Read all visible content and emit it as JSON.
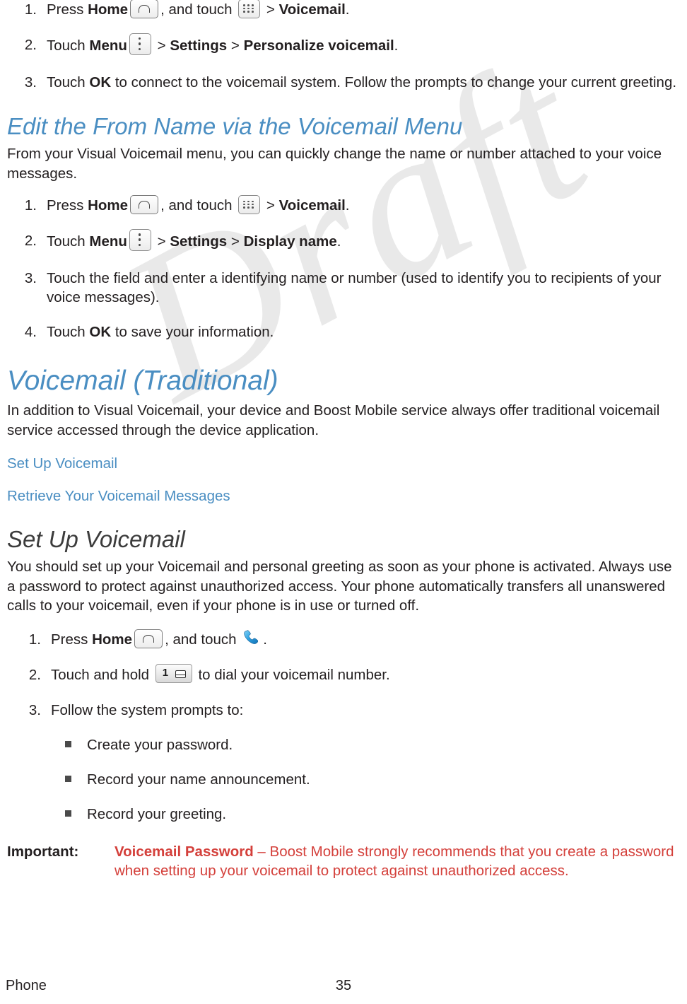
{
  "watermark": {
    "text": "Draft"
  },
  "steps_top": [
    {
      "num": "1.",
      "prefix": "Press ",
      "bold1": "Home",
      "mid": ", and touch ",
      "mid2": " > ",
      "bold2": "Voicemail",
      "suffix": "."
    },
    {
      "num": "2.",
      "prefix": "Touch ",
      "bold1": "Menu",
      "mid": " > ",
      "bold2": "Settings",
      "mid2": " > ",
      "bold3": "Personalize voicemail",
      "suffix": "."
    },
    {
      "num": "3.",
      "prefix": "Touch ",
      "bold1": "OK",
      "suffix": " to connect to the voicemail system. Follow the prompts to change your current greeting."
    }
  ],
  "section_edit_from_name": {
    "heading": "Edit the From Name via the Voicemail Menu",
    "intro": "From your Visual Voicemail menu, you can quickly change the name or number attached to your voice messages.",
    "steps": [
      {
        "num": "1.",
        "prefix": "Press ",
        "bold1": "Home",
        "mid": ", and touch ",
        "mid2": " > ",
        "bold2": "Voicemail",
        "suffix": "."
      },
      {
        "num": "2.",
        "prefix": "Touch ",
        "bold1": "Menu",
        "mid": " > ",
        "bold2": "Settings",
        "mid2": " > ",
        "bold3": "Display name",
        "suffix": "."
      },
      {
        "num": "3.",
        "text": "Touch the field and enter a identifying name or number (used to identify you to recipients of your voice messages)."
      },
      {
        "num": "4.",
        "prefix": "Touch ",
        "bold1": "OK",
        "suffix": " to save your information."
      }
    ]
  },
  "section_voicemail_traditional": {
    "heading": "Voicemail (Traditional)",
    "intro": "In addition to Visual Voicemail, your device and Boost Mobile service always offer traditional voicemail service accessed through the device application.",
    "links": [
      {
        "label": "Set Up Voicemail"
      },
      {
        "label": "Retrieve Your Voicemail Messages"
      }
    ]
  },
  "section_set_up_voicemail": {
    "heading": "Set Up Voicemail",
    "intro": "You should set up your Voicemail and personal greeting as soon as your phone is activated. Always use a password to protect against unauthorized access. Your phone automatically transfers all unanswered calls to your voicemail, even if your phone is in use or turned off.",
    "steps": [
      {
        "num": "1.",
        "prefix": "Press ",
        "bold1": "Home",
        "mid": ", and touch ",
        "suffix": "."
      },
      {
        "num": "2.",
        "prefix": "Touch and hold ",
        "suffix": " to dial your voicemail number."
      },
      {
        "num": "3.",
        "text": "Follow the system prompts to:"
      }
    ],
    "bullets": [
      {
        "label": "Create your password."
      },
      {
        "label": "Record your name announcement."
      },
      {
        "label": "Record your greeting."
      }
    ],
    "important": {
      "label": "Important:",
      "bold": "Voicemail Password",
      "text": " – Boost Mobile strongly recommends that you create a password when setting up your voicemail to protect against unauthorized access."
    }
  },
  "footer": {
    "left": "Phone",
    "page": "35"
  },
  "colors": {
    "heading_blue": "#4a8ec2",
    "heading_dark": "#3c3c3c",
    "important_red": "#d4403b",
    "body": "#231f20"
  }
}
